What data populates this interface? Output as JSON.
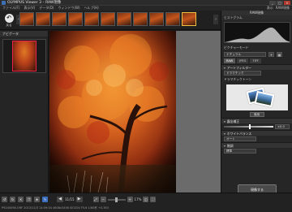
{
  "window": {
    "title": "OLYMPUS Viewer 3 – RAW現像",
    "buttons": [
      "_",
      "□",
      "×"
    ]
  },
  "menu": {
    "items": [
      "ファイル(F)",
      "表示(V)",
      "データ(D)",
      "ウィンドウ(W)",
      "ヘルプ(H)"
    ],
    "right": [
      "表示",
      "RAW現像"
    ]
  },
  "filmstrip": {
    "back_label": "戻る",
    "thumbnail_count": 12
  },
  "left_panel": {
    "title": "ナビゲータ"
  },
  "toolbar": {
    "page_count": "11/15",
    "zoom_value": "17%"
  },
  "status": {
    "text": "P9200098.ORF  2013/11/3 14:59:04  4608x3456  ISO200  F5.6  1/60秒  +0.3EV"
  },
  "right_panel": {
    "header": "RAW現像",
    "histogram_label": "ヒストグラム",
    "picture_mode_label": "ピクチャーモード",
    "picture_mode_value": "ナチュラル",
    "tabs": [
      "RAW",
      "JPEG",
      "TIFF"
    ],
    "art_filter_section": "アートフィルター",
    "art_filter_value": "ドラマチック",
    "art_filter_sub": "ドラマチックトーン",
    "apply_label": "適用",
    "exposure_section": "露出補正",
    "exposure_value": "±0.0",
    "wb_section": "ホワイトバランス",
    "wb_value": "オート",
    "gradation_section": "階調",
    "gradation_value": "標準",
    "exec_label": "現像する"
  },
  "colors": {
    "accent": "#3c6fc0",
    "selection": "#f0c040"
  }
}
